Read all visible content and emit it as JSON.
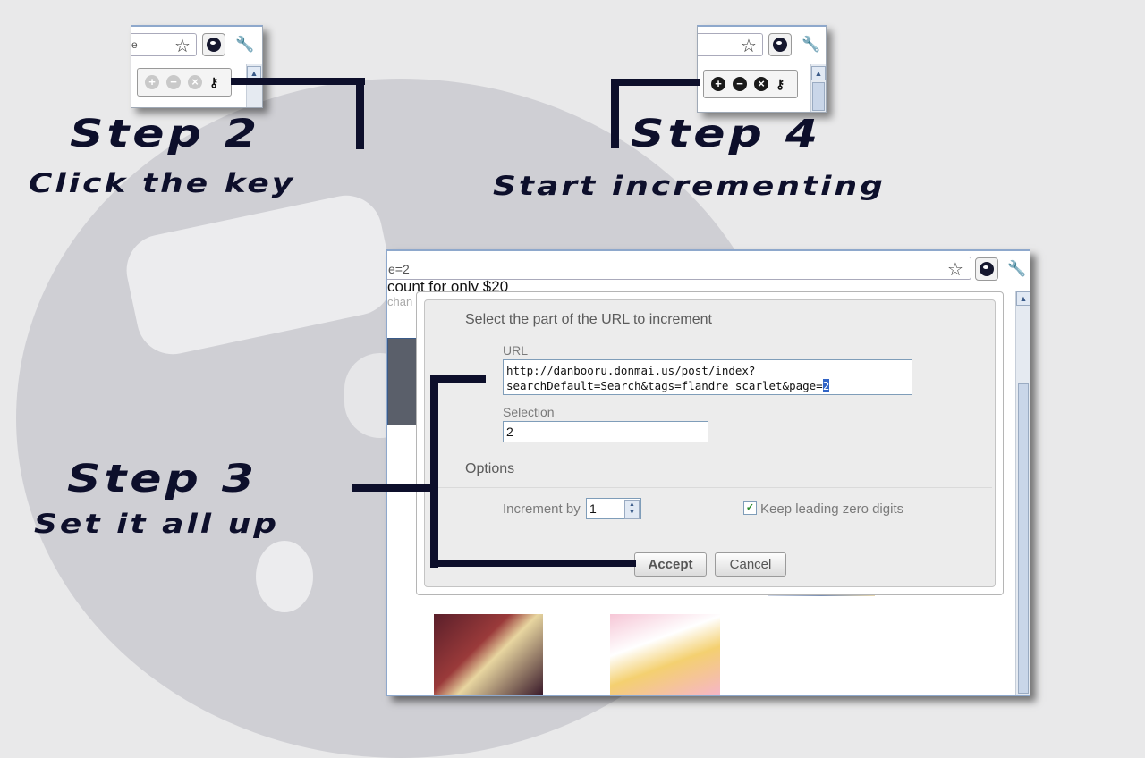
{
  "steps": {
    "step2": {
      "title": "Step 2",
      "subtitle": "Click the key"
    },
    "step3": {
      "title": "Step 3",
      "subtitle": "Set it all up"
    },
    "step4": {
      "title": "Step 4",
      "subtitle": "Start incrementing"
    }
  },
  "mini_left": {
    "omnibox_fragment": "e",
    "buttons": [
      "plus-disabled",
      "minus-disabled",
      "cancel-disabled",
      "key"
    ]
  },
  "mini_right": {
    "buttons": [
      "plus",
      "minus",
      "cancel",
      "key"
    ]
  },
  "browser": {
    "omnibox_value": "e=2",
    "page_text_line1": "count for only $20",
    "page_text_line2": "chan"
  },
  "dialog": {
    "title": "Select the part of the URL to increment",
    "url_label": "URL",
    "url_line1": "http://danbooru.donmai.us/post/index?",
    "url_line2_prefix": "searchDefault=Search&tags=flandre_scarlet&page=",
    "url_selected": "2",
    "selection_label": "Selection",
    "selection_value": "2",
    "options_label": "Options",
    "increment_label": "Increment by",
    "increment_value": "1",
    "leading_zero_label": "Keep leading zero digits",
    "leading_zero_checked": true,
    "accept_label": "Accept",
    "cancel_label": "Cancel"
  },
  "colors": {
    "accent_dark": "#0d0f2b",
    "selection_blue": "#3164c6"
  }
}
